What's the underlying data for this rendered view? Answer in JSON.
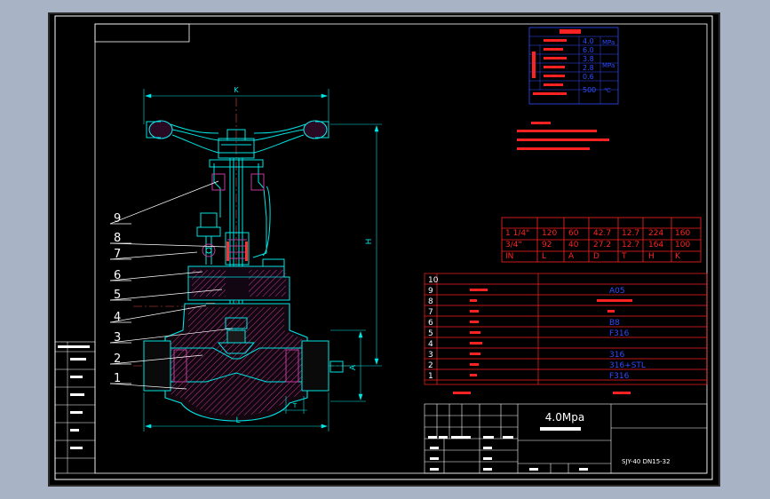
{
  "balloons": [
    "1",
    "2",
    "3",
    "4",
    "5",
    "6",
    "7",
    "8",
    "9"
  ],
  "dimensions": {
    "k": "K",
    "h": "H",
    "l": "L",
    "a": "A",
    "t": "T"
  },
  "params_table": {
    "values": [
      "4.0",
      "6.0",
      "3.8",
      "2.8",
      "0.6",
      "500"
    ],
    "units": [
      "MPa",
      "MPa",
      "℃"
    ]
  },
  "size_table": {
    "rows": [
      [
        "1 1/4\"",
        "120",
        "60",
        "42.7",
        "12.7",
        "224",
        "160"
      ],
      [
        "3/4\"",
        "92",
        "40",
        "27.2",
        "12.7",
        "164",
        "100"
      ]
    ],
    "headers": [
      "IN",
      "L",
      "A",
      "D",
      "T",
      "H",
      "K"
    ]
  },
  "parts_list": {
    "numbers": [
      "10",
      "9",
      "8",
      "7",
      "6",
      "5",
      "4",
      "3",
      "2",
      "1"
    ],
    "materials": [
      "",
      "A05",
      "",
      "",
      "B8",
      "F316",
      "",
      "316",
      "316+STL",
      "F316"
    ]
  },
  "title_block": {
    "pressure": "4.0Mpa",
    "drawing_no": "SJY-40 DN15-32"
  },
  "colors": {
    "background": "#000000",
    "sheet_frame": "#ffffff",
    "drawing": "#00e5e5",
    "body_hatch": "#c03a9a",
    "centerline": "#e04444",
    "text_blue": "#2f4cff",
    "text_red": "#ff2222"
  }
}
